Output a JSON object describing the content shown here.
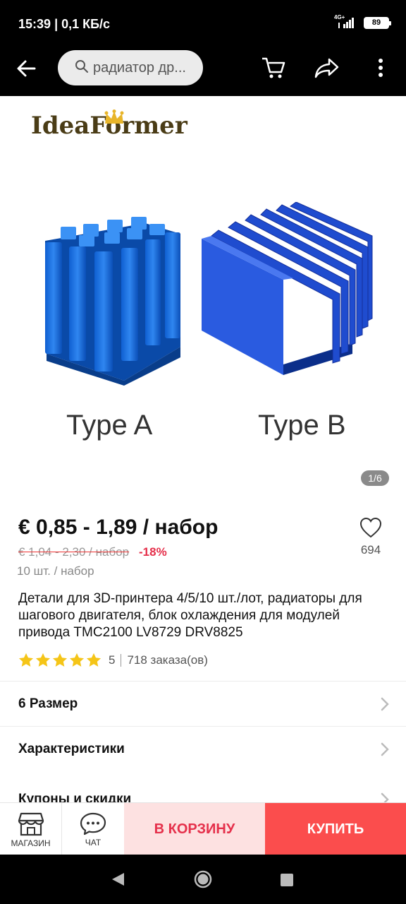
{
  "status": {
    "time": "15:39",
    "net_speed": "| 0,1 КБ/с",
    "network": "4G+",
    "battery": "89"
  },
  "appbar": {
    "search_text": "радиатор др...",
    "icons": [
      "back-arrow-icon",
      "search-icon",
      "cart-icon",
      "share-icon",
      "more-vertical-icon"
    ]
  },
  "gallery": {
    "brand": "IdeaFormer",
    "label_a": "Type A",
    "label_b": "Type B",
    "counter": "1/6",
    "heatsink_color": "#1e73e8"
  },
  "product": {
    "price": "€ 0,85 - 1,89 / набор",
    "old_price": "€ 1,04 - 2,30 / набор",
    "discount": "-18%",
    "unit": "10 шт. / набор",
    "wishlist_count": "694",
    "title": "Детали для 3D-принтера 4/5/10 шт./лот, радиаторы для шагового двигателя, блок охлаждения для модулей привода TMC2100 LV8729 DRV8825",
    "rating": "5",
    "rating_stars": 5,
    "orders": "718 заказа(ов)",
    "star_color": "#f5c518"
  },
  "rows": {
    "size": "6 Размер",
    "specs": "Характеристики",
    "coupons": "Купоны и скидки"
  },
  "actions": {
    "store": "МАГАЗИН",
    "chat": "ЧАТ",
    "add_to_cart": "В КОРЗИНУ",
    "buy": "КУПИТЬ",
    "cart_bg": "#fde1e1",
    "buy_bg": "#fb4d4d"
  }
}
